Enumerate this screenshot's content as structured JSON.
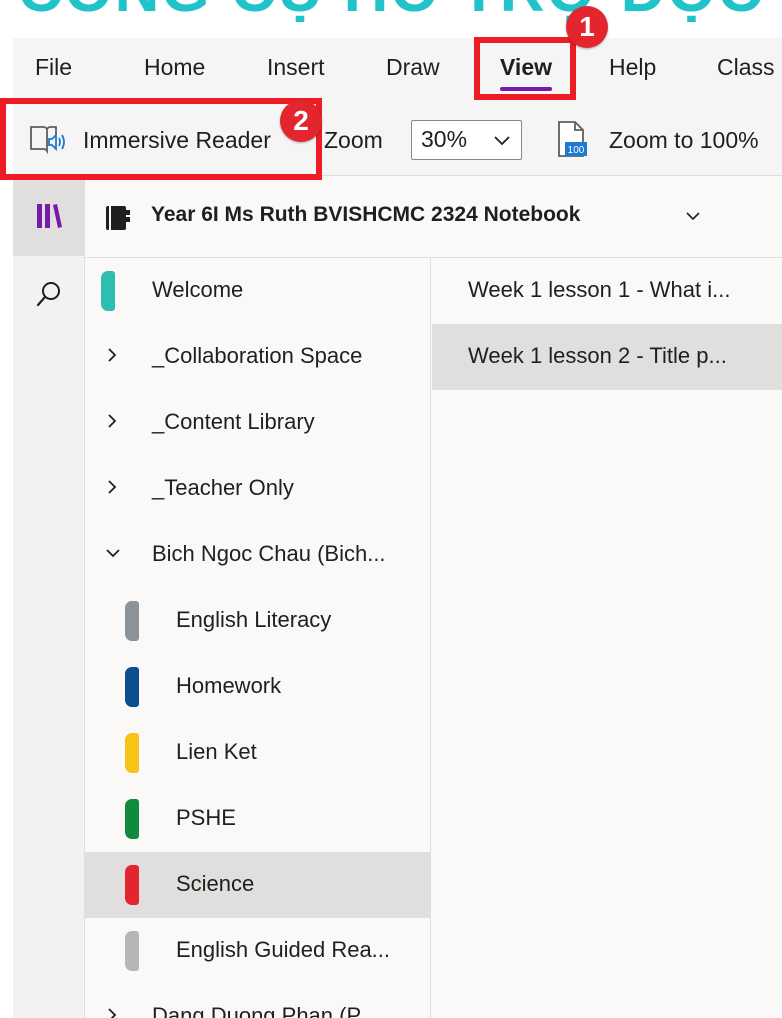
{
  "banner": {
    "text": "CÔNG CỤ HỖ TRỢ ĐỌC"
  },
  "menu": {
    "items": [
      {
        "label": "File"
      },
      {
        "label": "Home"
      },
      {
        "label": "Insert"
      },
      {
        "label": "Draw"
      },
      {
        "label": "View",
        "active": true
      },
      {
        "label": "Help"
      },
      {
        "label": "Class"
      }
    ]
  },
  "ribbon": {
    "immersive_reader": "Immersive Reader",
    "zoom_label": "Zoom",
    "zoom_value": "30%",
    "zoom_to_100": "Zoom to 100%"
  },
  "notebook": {
    "title": "Year 6I Ms Ruth BVISHCMC 2324 Notebook"
  },
  "sections": [
    {
      "label": "Welcome",
      "type": "tab",
      "color": "#2dbeb1"
    },
    {
      "label": "_Collaboration Space",
      "type": "group",
      "expanded": false
    },
    {
      "label": "_Content Library",
      "type": "group",
      "expanded": false
    },
    {
      "label": "_Teacher Only",
      "type": "group",
      "expanded": false
    },
    {
      "label": "Bich Ngoc Chau (Bich...",
      "type": "group",
      "expanded": true
    },
    {
      "label": "English Literacy",
      "type": "tab",
      "color": "#8c9299"
    },
    {
      "label": "Homework",
      "type": "tab",
      "color": "#0b4f8f"
    },
    {
      "label": "Lien Ket",
      "type": "tab",
      "color": "#f7c314"
    },
    {
      "label": "PSHE",
      "type": "tab",
      "color": "#0f8a3e"
    },
    {
      "label": "Science",
      "type": "tab",
      "color": "#e3262e",
      "selected": true
    },
    {
      "label": "English Guided Rea...",
      "type": "tab",
      "color": "#b6b6b6"
    },
    {
      "label": "Dang Duong Phan (P...",
      "type": "group",
      "expanded": false
    }
  ],
  "pages": [
    {
      "label": "Week 1 lesson 1 - What i..."
    },
    {
      "label": "Week 1 lesson 2 - Title p...",
      "selected": true
    }
  ],
  "callouts": [
    {
      "number": "1"
    },
    {
      "number": "2"
    }
  ],
  "colors": {
    "accent": "#7719aa",
    "callout": "#ee1c24",
    "banner": "#1fc3c9"
  },
  "icons": [
    "immersive-reader-icon",
    "zoom-to-100-icon",
    "notebook-icon",
    "notebooks-library-icon",
    "search-icon",
    "chevron-down-icon",
    "chevron-right-icon"
  ]
}
